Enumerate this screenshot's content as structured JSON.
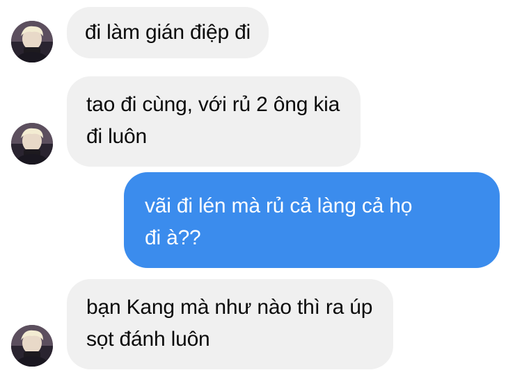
{
  "conversation": {
    "accent_color": "#3b8ced",
    "incoming_bg": "#f0f0f0",
    "messages": [
      {
        "sender": "contact",
        "lines": [
          "đi làm gián điệp đi"
        ]
      },
      {
        "sender": "contact",
        "lines": [
          "tao đi cùng, với rủ 2 ông kia",
          "đi luôn"
        ]
      },
      {
        "sender": "me",
        "lines": [
          "vãi đi lén mà rủ cả làng cả họ",
          "đi à??"
        ]
      },
      {
        "sender": "contact",
        "lines": [
          "bạn Kang mà như nào thì ra úp",
          "sọt đánh luôn"
        ]
      }
    ]
  }
}
